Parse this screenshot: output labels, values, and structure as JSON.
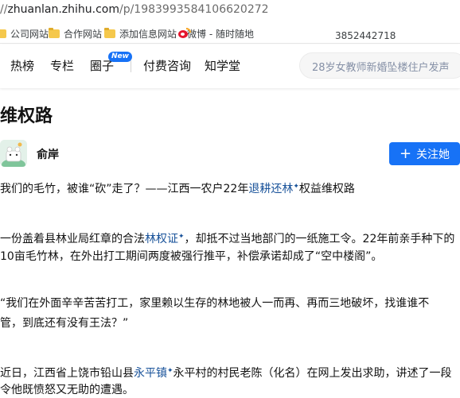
{
  "browser": {
    "url_prefix": "//",
    "url_host": "zhuanlan.zhihu.com",
    "url_path": "/p/1983993584106620272",
    "bookmarks": [
      {
        "label": "公司网站",
        "icon": "folder-icon"
      },
      {
        "label": "合作网站",
        "icon": "folder-icon"
      },
      {
        "label": "添加信息网站",
        "icon": "folder-icon"
      },
      {
        "label": "微博 - 随时随地",
        "icon": "weibo-icon"
      }
    ],
    "phone_number": "3852442718"
  },
  "header": {
    "nav": [
      {
        "label": "热榜"
      },
      {
        "label": "专栏"
      },
      {
        "label": "圈子",
        "badge": "New"
      },
      {
        "label": "付费咨询"
      },
      {
        "label": "知学堂"
      }
    ],
    "search_placeholder": "28岁女教师新婚坠楼住户发声"
  },
  "article": {
    "title": "维权路",
    "author": "俞岸",
    "follow_label": "关注她",
    "paragraphs": {
      "p1": {
        "pre": "我们的毛竹，被谁“砍”走了？——江西一农户22年",
        "link": "退耕还林",
        "post": "权益维权路"
      },
      "p2a": {
        "pre": "一份盖着县林业局红章的合法",
        "link": "林权证",
        "post": "，却抵不过当地部门的一纸施工令。22年前亲手种下的"
      },
      "p2b": "10亩毛竹林，在外出打工期间两度被强行推平，补偿承诺却成了“空中楼阁”。",
      "p3a": "“我们在外面辛辛苦苦打工，家里赖以生存的林地被人一而再、再而三地破坏，找谁谁不",
      "p3b": "管，到底还有没有王法？”",
      "p4a": {
        "pre": "近日，江西省上饶市铅山县",
        "link": "永平镇",
        "post": "永平村的村民老陈（化名）在网上发出求助，讲述了一段"
      },
      "p4b": "令他既愤怒又无助的遭遇。"
    }
  },
  "colors": {
    "brand_blue": "#1772f6",
    "link_blue": "#175199",
    "text": "#121212"
  }
}
